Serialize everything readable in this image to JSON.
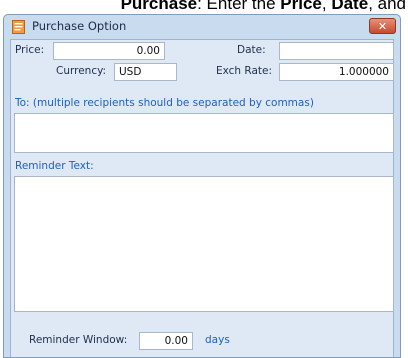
{
  "caption": {
    "bold_1": "Purchase",
    "text_1": ": Enter the ",
    "bold_2": "Price",
    "text_2": ", ",
    "bold_3": "Date",
    "text_3": ", and"
  },
  "window": {
    "title": "Purchase Option",
    "close_glyph": "✕",
    "app_icon": "document-icon"
  },
  "form": {
    "price_label": "Price:",
    "price_value": "0.00",
    "date_label": "Date:",
    "date_value": "",
    "currency_label": "Currency:",
    "currency_value": "USD",
    "exch_rate_label": "Exch Rate:",
    "exch_rate_value": "1.000000",
    "to_label": "To: (multiple recipients should be separated by commas)",
    "to_value": "",
    "reminder_text_label": "Reminder Text:",
    "reminder_text_value": "",
    "reminder_window_label": "Reminder Window:",
    "reminder_window_value": "0.00",
    "reminder_window_unit": "days"
  },
  "colors": {
    "window_frame": "#c9dbef",
    "client_bg": "#dfe9f5",
    "label_blue": "#1f5fbf",
    "close_red": "#c44b2e"
  }
}
